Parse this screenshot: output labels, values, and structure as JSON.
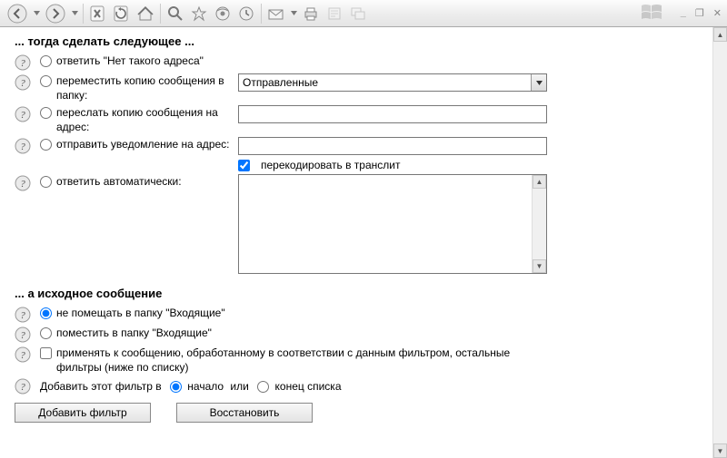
{
  "toolbar": {
    "icons": [
      "back",
      "forward",
      "stop",
      "refresh",
      "home",
      "search",
      "favorites",
      "media",
      "history",
      "mail",
      "print",
      "edit",
      "discuss"
    ]
  },
  "section1": {
    "title": "... тогда сделать следующее ...",
    "opt1": "ответить \"Нет такого адреса\"",
    "opt2": "переместить копию сообщения в папку:",
    "opt2_select": "Отправленные",
    "opt3": "переслать копию сообщения на адрес:",
    "opt3_value": "",
    "opt4": "отправить уведомление на адрес:",
    "opt4_value": "",
    "opt4_checkbox": "перекодировать в транслит",
    "opt5": "ответить автоматически:",
    "opt5_value": ""
  },
  "section2": {
    "title": "... а исходное сообщение",
    "opt1": "не помещать в папку \"Входящие\"",
    "opt2": "поместить в папку \"Входящие\"",
    "apply_rest": "применять к сообщению, обработанному в соответствии с данным фильтром, остальные фильтры (ниже по списку)",
    "insert_prefix": "Добавить этот фильтр в",
    "insert_begin": "начало",
    "insert_or": "или",
    "insert_end": "конец списка"
  },
  "buttons": {
    "add": "Добавить фильтр",
    "restore": "Восстановить"
  }
}
